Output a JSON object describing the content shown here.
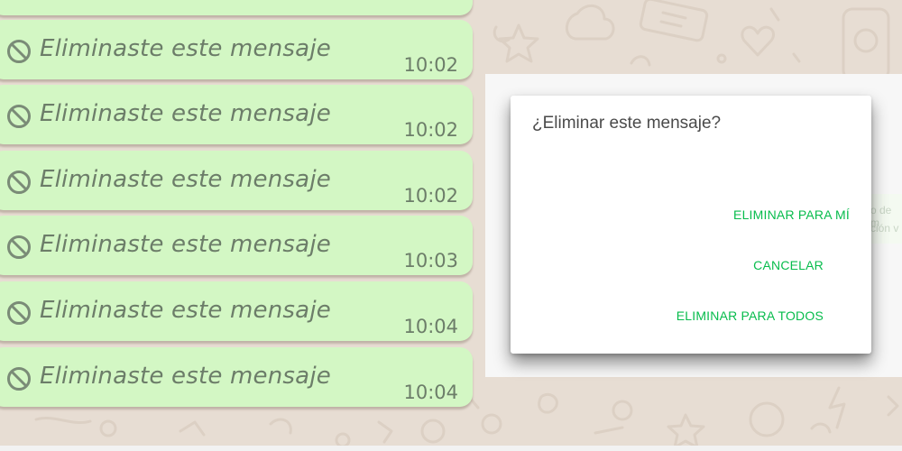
{
  "chat": {
    "deleted_text": "Eliminaste este mensaje",
    "messages": [
      {
        "text": "Eliminaste este mensaje",
        "time": "10:02"
      },
      {
        "text": "Eliminaste este mensaje",
        "time": "10:02"
      },
      {
        "text": "Eliminaste este mensaje",
        "time": "10:02"
      },
      {
        "text": "Eliminaste este mensaje",
        "time": "10:03"
      },
      {
        "text": "Eliminaste este mensaje",
        "time": "10:04"
      },
      {
        "text": "Eliminaste este mensaje",
        "time": "10:04"
      }
    ],
    "icon": "ban-icon",
    "bubble_color": "#d3f7c4"
  },
  "background_snippets": [
    "o de m",
    "ción v"
  ],
  "dialog": {
    "title": "¿Eliminar este mensaje?",
    "delete_for_me": "ELIMINAR PARA MÍ",
    "cancel": "CANCELAR",
    "delete_for_all": "ELIMINAR PARA TODOS",
    "accent_color": "#07bc4c"
  }
}
